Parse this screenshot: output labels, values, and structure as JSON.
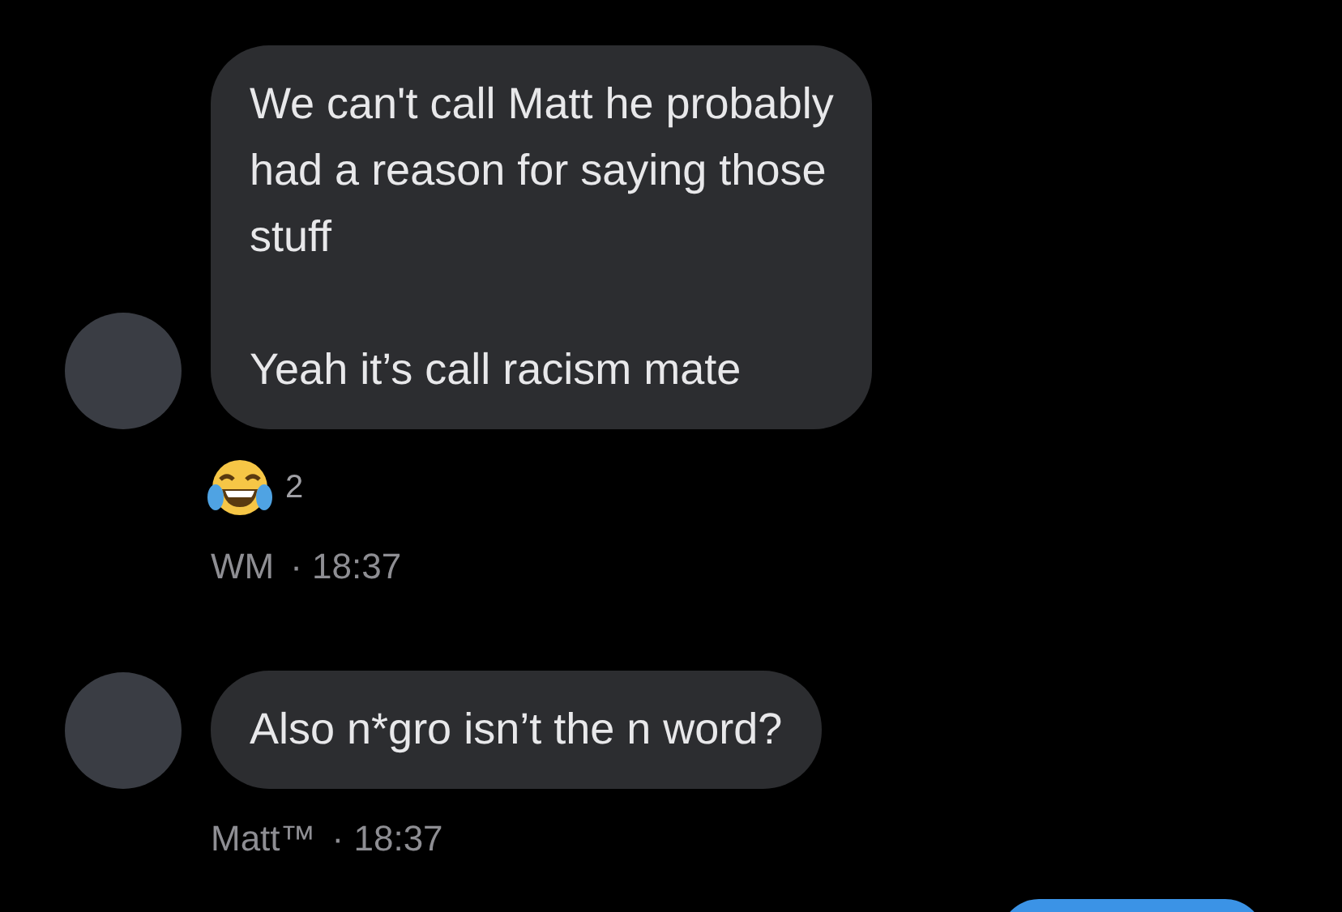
{
  "messages": [
    {
      "text": "We can't call Matt he probably\nhad a reason for saying those\nstuff\n\nYeah it’s call racism mate",
      "reaction": {
        "count": "2"
      },
      "sender": "WM",
      "time": "· 18:37"
    },
    {
      "text": "Also n*gro isn’t the n word?",
      "sender": "Matt™",
      "time": "· 18:37"
    }
  ]
}
